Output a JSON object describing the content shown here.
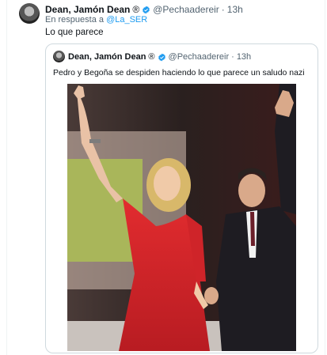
{
  "tweet": {
    "author_name": "Dean, Jamón Dean",
    "author_flag": "®",
    "handle": "@Pechaadereir",
    "separator": "·",
    "time": "13h",
    "reply_prefix": "En respuesta a",
    "reply_to": "@La_SER",
    "text": "Lo que parece"
  },
  "quoted_tweet": {
    "author_name": "Dean, Jamón Dean",
    "author_flag": "®",
    "handle": "@Pechaadereir",
    "separator": "·",
    "time": "13h",
    "text": "Pedro y Begoña se despiden haciendo lo que parece un saludo nazi"
  },
  "colors": {
    "accent": "#1d9bf0",
    "muted": "#536471",
    "dress": "#d8252b",
    "backdrop_green": "#a9b65a"
  },
  "icons": [
    "verified-badge-icon"
  ]
}
